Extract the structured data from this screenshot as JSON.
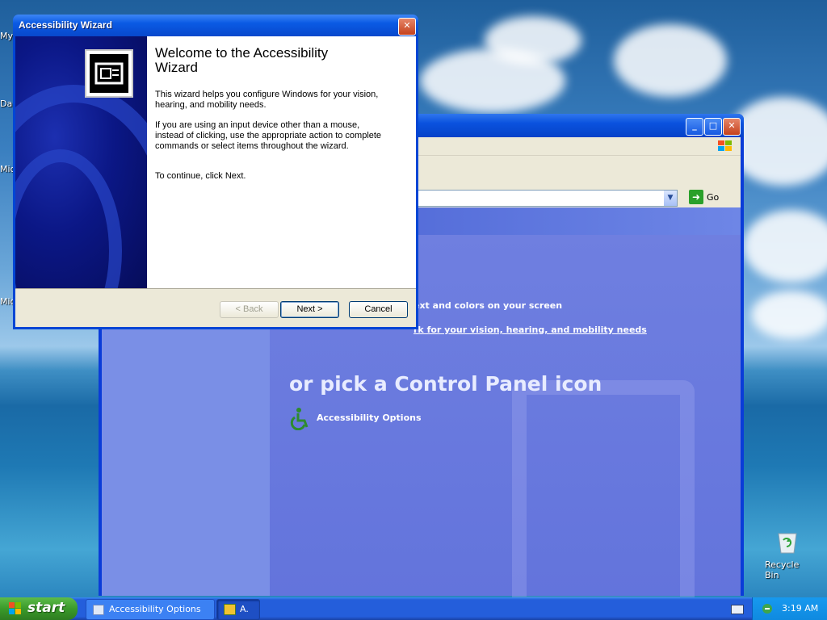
{
  "desktop": {
    "icon_labels": [
      "My",
      "Da",
      "Mic",
      "Mic"
    ],
    "recycle_bin": "Recycle Bin"
  },
  "control_panel": {
    "address_go": "Go",
    "task_colors": "ext and colors on your screen",
    "task_configure": "rk for your vision, hearing, and mobility needs",
    "pick_heading": "or pick a Control Panel icon",
    "accessibility_options": "Accessibility Options"
  },
  "wizard": {
    "title": "Accessibility Wizard",
    "heading": "Welcome to the Accessibility Wizard",
    "para1": "This wizard helps you configure Windows for your vision, hearing, and mobility needs.",
    "para2": "If you are using an input device other than a mouse, instead of clicking, use the appropriate action to complete commands or select items throughout the wizard.",
    "para3": "To continue, click Next.",
    "back_label": "< Back",
    "next_label": "Next >",
    "cancel_label": "Cancel"
  },
  "taskbar": {
    "start_label": "start",
    "items": [
      "Accessibility Options",
      "A."
    ],
    "clock": "3:19 AM"
  },
  "colors": {
    "title_bar_blue": "#0a52de",
    "close_red": "#c5411c",
    "control_panel_bg": "#6374dc",
    "start_green": "#3a9a2a"
  }
}
